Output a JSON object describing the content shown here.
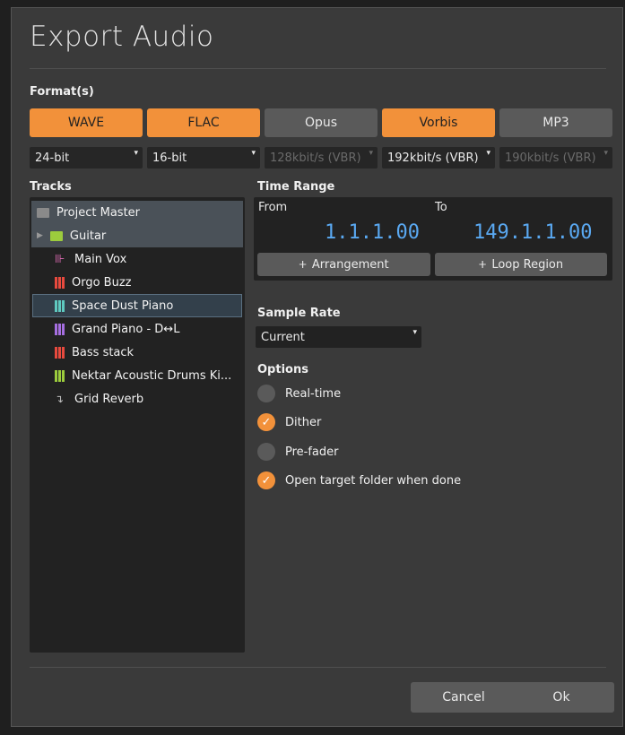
{
  "dialog": {
    "title": "Export Audio"
  },
  "formats": {
    "label": "Format(s)",
    "buttons": [
      {
        "label": "WAVE",
        "active": true
      },
      {
        "label": "FLAC",
        "active": true
      },
      {
        "label": "Opus",
        "active": false
      },
      {
        "label": "Vorbis",
        "active": true
      },
      {
        "label": "MP3",
        "active": false
      }
    ],
    "dropdowns": [
      {
        "value": "24-bit",
        "enabled": true
      },
      {
        "value": "16-bit",
        "enabled": true
      },
      {
        "value": "128kbit/s (VBR)",
        "enabled": false
      },
      {
        "value": "192kbit/s (VBR)",
        "enabled": true
      },
      {
        "value": "190kbit/s (VBR)",
        "enabled": false
      }
    ]
  },
  "tracks": {
    "label": "Tracks",
    "items": [
      {
        "name": "Project Master",
        "icon": "folder-icon",
        "color": "#8a8a8a"
      },
      {
        "name": "Guitar",
        "icon": "folder-icon",
        "color": "#9ccc3d"
      },
      {
        "name": "Main Vox",
        "icon": "audio-wave-icon",
        "color": "#e06cb6"
      },
      {
        "name": "Orgo Buzz",
        "icon": "instrument-icon",
        "color": "#e84a3e"
      },
      {
        "name": "Space Dust Piano",
        "icon": "instrument-icon",
        "color": "#5fc9c0"
      },
      {
        "name": "Grand Piano - D↔L",
        "icon": "instrument-icon",
        "color": "#a56ee0"
      },
      {
        "name": "Bass stack",
        "icon": "instrument-icon",
        "color": "#e84a3e"
      },
      {
        "name": "Nektar Acoustic Drums Ki...",
        "icon": "instrument-icon",
        "color": "#9ccc3d"
      },
      {
        "name": "Grid Reverb",
        "icon": "effect-return-icon",
        "color": "#bdbdbd"
      }
    ]
  },
  "time_range": {
    "label": "Time Range",
    "from_label": "From",
    "to_label": "To",
    "from_value": "1.1.1.00",
    "to_value": "149.1.1.00",
    "arrangement_button": "Arrangement",
    "loop_button": "Loop Region",
    "button_icon": "ⵜ"
  },
  "sample_rate": {
    "label": "Sample Rate",
    "value": "Current"
  },
  "options": {
    "label": "Options",
    "items": [
      {
        "label": "Real-time",
        "checked": false
      },
      {
        "label": "Dither",
        "checked": true
      },
      {
        "label": "Pre-fader",
        "checked": false
      },
      {
        "label": "Open target folder when done",
        "checked": true
      }
    ]
  },
  "footer": {
    "cancel": "Cancel",
    "ok": "Ok"
  },
  "colors": {
    "accent": "#f2913a",
    "time": "#5aa9f2"
  }
}
